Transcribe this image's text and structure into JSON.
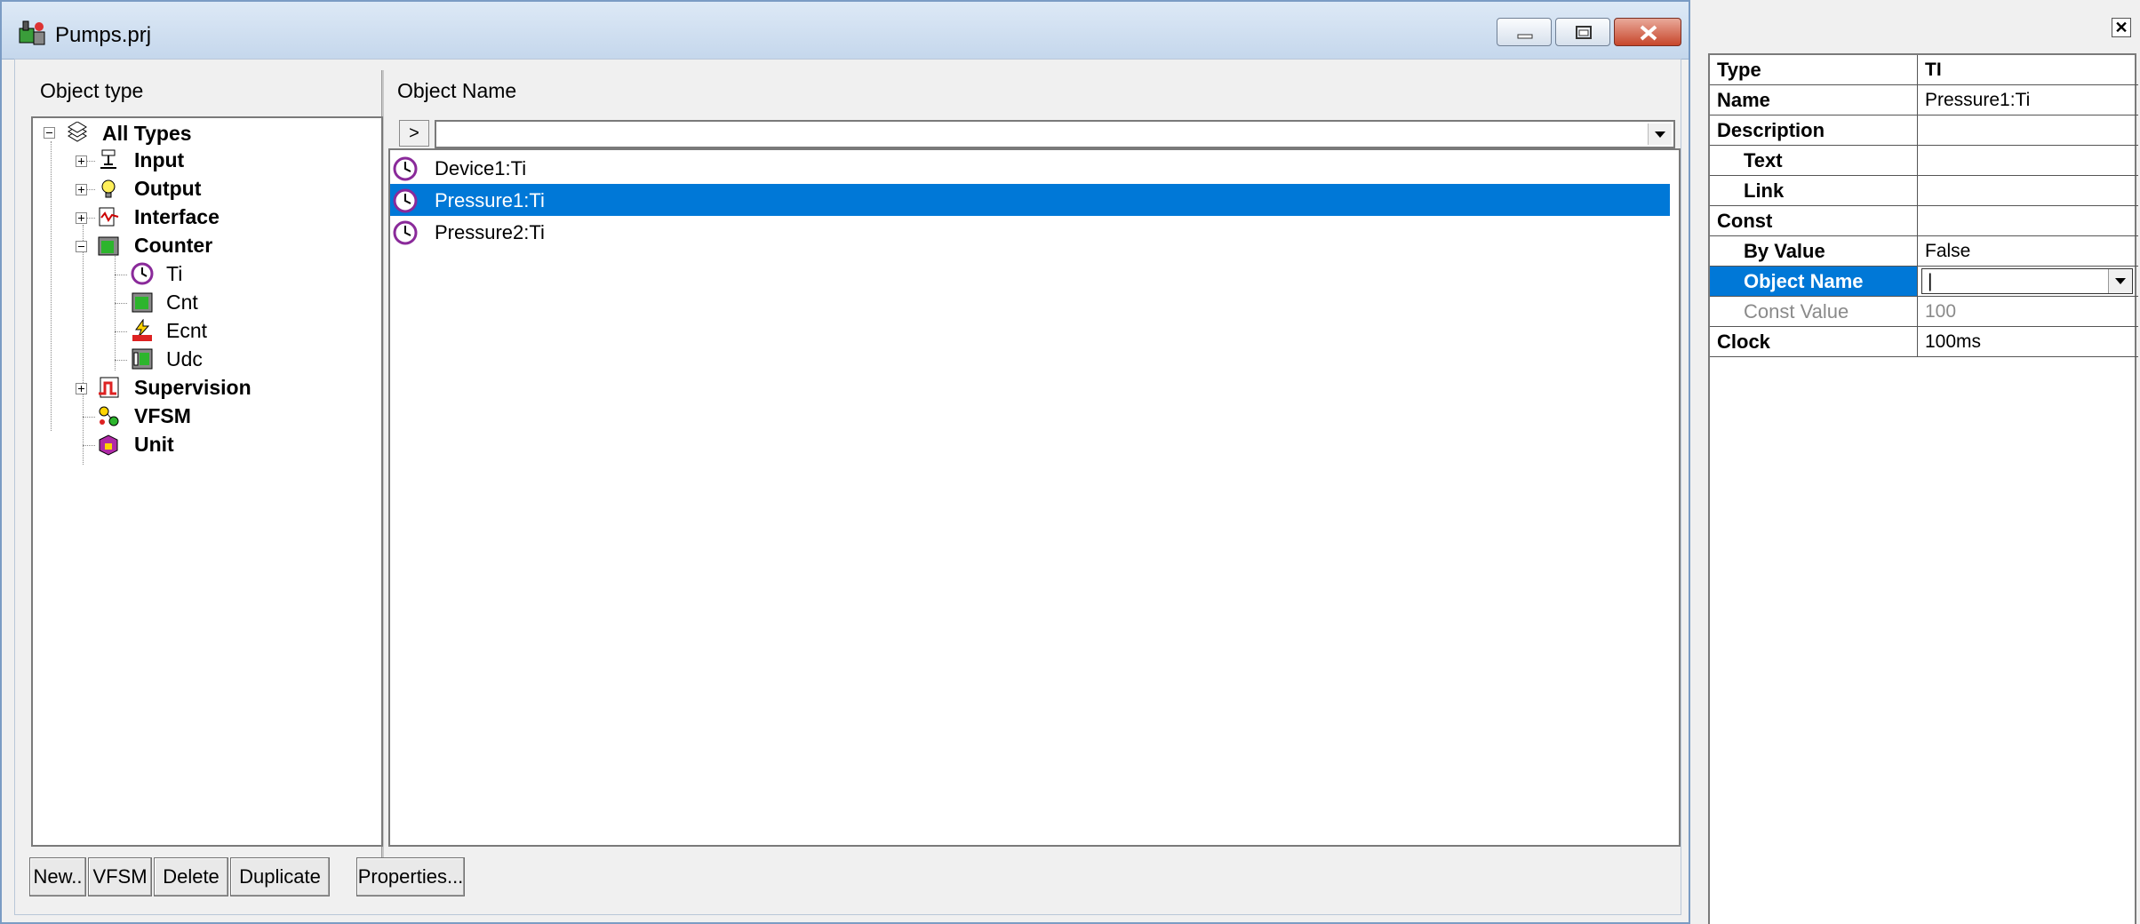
{
  "window": {
    "title": "Pumps.prj",
    "object_type_header": "Object type",
    "object_name_header": "Object Name"
  },
  "tree": {
    "root": "All Types",
    "nodes": [
      "Input",
      "Output",
      "Interface",
      "Counter",
      "Supervision",
      "VFSM",
      "Unit"
    ],
    "counter_children": [
      "Ti",
      "Cnt",
      "Ecnt",
      "Udc"
    ]
  },
  "filter": {
    "button_label": ">",
    "value": ""
  },
  "objects": [
    {
      "name": "Device1:Ti",
      "selected": false
    },
    {
      "name": "Pressure1:Ti",
      "selected": true
    },
    {
      "name": "Pressure2:Ti",
      "selected": false
    }
  ],
  "buttons": {
    "new": "New..",
    "vfsm": "VFSM",
    "delete": "Delete",
    "duplicate": "Duplicate",
    "properties": "Properties..."
  },
  "properties": {
    "close_glyph": "✕",
    "rows": [
      {
        "key": "Type",
        "value": "TI"
      },
      {
        "key": "Name",
        "value": "Pressure1:Ti"
      },
      {
        "key": "Description",
        "value": ""
      },
      {
        "key": "Text",
        "value": ""
      },
      {
        "key": "Link",
        "value": ""
      },
      {
        "key": "Const",
        "value": ""
      },
      {
        "key": "By Value",
        "value": "False"
      },
      {
        "key": "Object Name",
        "value": "|"
      },
      {
        "key": "Const Value",
        "value": "100"
      },
      {
        "key": "Clock",
        "value": "100ms"
      }
    ]
  },
  "colors": {
    "selection": "#0078d7",
    "accent": "#c7462b"
  }
}
